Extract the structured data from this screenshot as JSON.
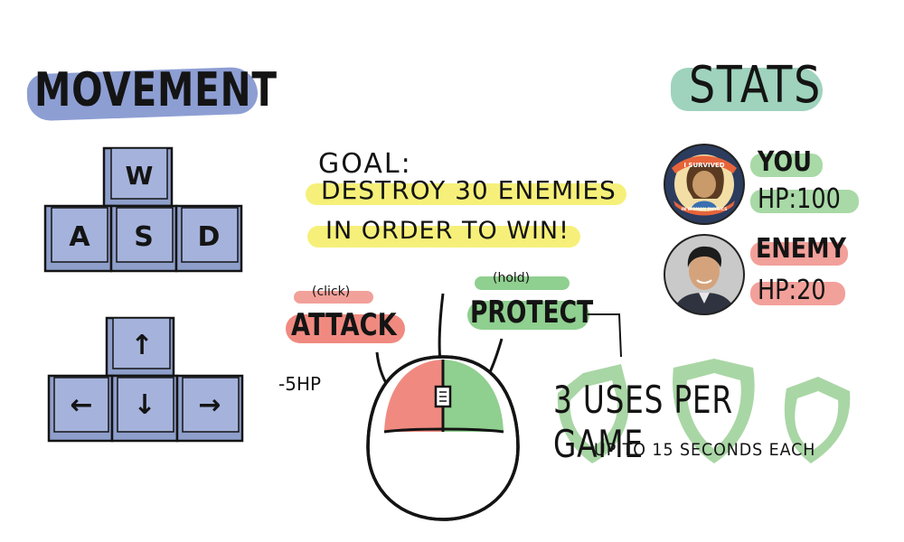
{
  "colors": {
    "key_fill": "#8f9fcb",
    "key_top": "#a5b3dc",
    "movement_highlight": "#8d9ed3",
    "stats_highlight": "#9fd3bd",
    "goal_highlight": "#f6f07a",
    "attack_red": "#f08a80",
    "protect_green": "#8fcf8f",
    "you_green": "#a8d9a6",
    "enemy_red": "#f2a09a",
    "shield_green": "#a9d6a5",
    "ink": "#141414"
  },
  "movement": {
    "title": "MOVEMENT",
    "wasd_keys": [
      "W",
      "A",
      "S",
      "D"
    ],
    "arrow_keys": [
      "↑",
      "←",
      "↓",
      "→"
    ]
  },
  "goal": {
    "label": "GOAL:",
    "line1": "DESTROY 30 ENEMIES",
    "line2": "IN ORDER TO WIN!"
  },
  "mouse": {
    "attack_hint": "(click)",
    "attack_label": "ATTACK",
    "attack_damage": "-5HP",
    "protect_hint": "(hold)",
    "protect_label": "PROTECT",
    "protect_uses": "3 USES PER GAME",
    "protect_duration": "UP TO 15 SECONDS EACH"
  },
  "stats": {
    "title": "STATS",
    "you": {
      "name": "YOU",
      "hp": "HP:100",
      "badge_top": "I SURVIVED",
      "badge_bottom": "IN WOMAN PHYSICS",
      "avatar_icon": "badge-avatar-icon"
    },
    "enemy": {
      "name": "ENEMY",
      "hp": "HP:20",
      "avatar_icon": "person-photo-icon"
    }
  }
}
